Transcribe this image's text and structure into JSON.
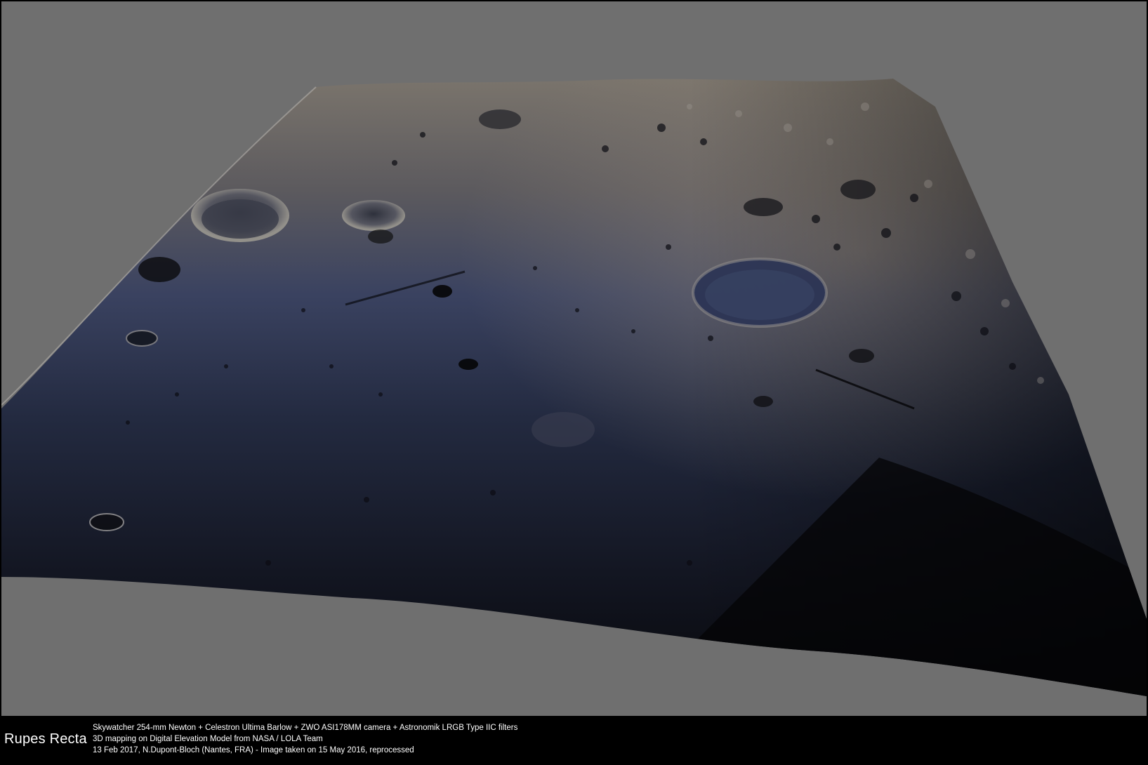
{
  "caption": {
    "title": "Rupes Recta",
    "lines": [
      "Skywatcher 254-mm Newton + Celestron Ultima Barlow + ZWO ASI178MM camera + Astronomik LRGB Type IIC filters",
      "3D mapping on Digital Elevation Model from NASA / LOLA Team",
      "13 Feb 2017, N.Dupont-Bloch (Nantes, FRA) - Image taken on 15 May 2016, reprocessed"
    ]
  },
  "colors": {
    "background": "#6f6f6f",
    "surface_near": "#10121c",
    "surface_mid": "#2a3148",
    "surface_far": "#6e6a66",
    "caption_bg": "#000000",
    "caption_text": "#ffffff"
  },
  "image": {
    "subject": "3D rendered lunar terrain"
  }
}
